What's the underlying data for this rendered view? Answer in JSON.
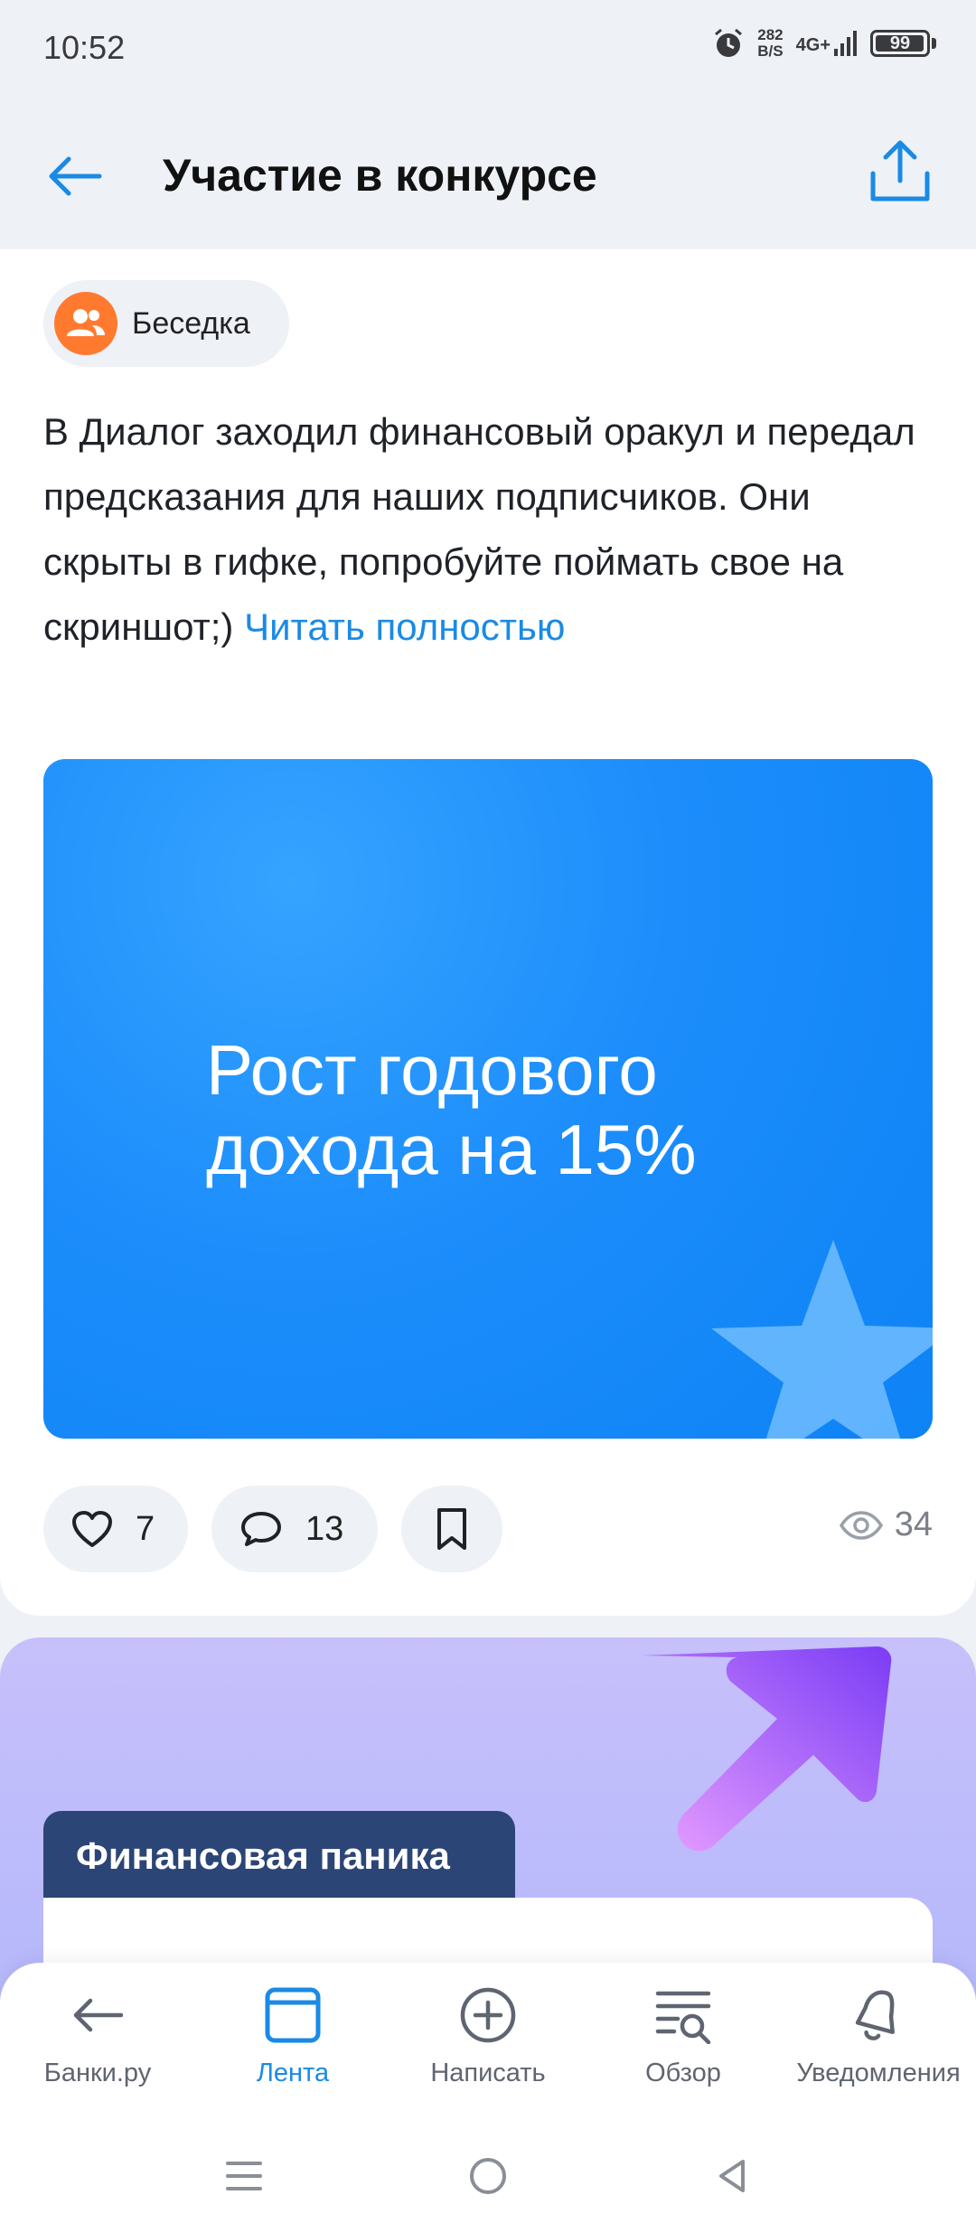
{
  "status_bar": {
    "time": "10:52",
    "net_speed_value": "282",
    "net_speed_unit": "B/S",
    "network": "4G+",
    "battery": "99",
    "battery_fraction": 0.99
  },
  "header": {
    "title": "Участие в конкурсе",
    "back_icon": "arrow-left-icon",
    "share_icon": "share-upload-icon"
  },
  "post": {
    "community": "Беседка",
    "text": "В Диалог заходил финансовый оракул и передал предсказания для наших подписчиков. Они скрыты в гифке, попробуйте поймать свое на скриншот;) ",
    "read_more": "Читать полностью",
    "gif_text": [
      "Рост годового",
      "дохода на 15%"
    ],
    "likes": "7",
    "comments": "13",
    "views": "34"
  },
  "promo": {
    "tag": "Финансовая паника"
  },
  "bottom_nav": [
    {
      "label": "Банки.ру",
      "icon": "arrow-left-icon",
      "active": false
    },
    {
      "label": "Лента",
      "icon": "feed-icon",
      "active": true
    },
    {
      "label": "Написать",
      "icon": "plus-circle-icon",
      "active": false
    },
    {
      "label": "Обзор",
      "icon": "search-list-icon",
      "active": false
    },
    {
      "label": "Уведомления",
      "icon": "bell-icon",
      "active": false
    }
  ],
  "colors": {
    "accent": "#1a8ae5",
    "background": "#eef1f6",
    "gif_blue": "#0e83f5",
    "chip_avatar": "#ff7a2f",
    "promo_tag": "#2c4577"
  }
}
